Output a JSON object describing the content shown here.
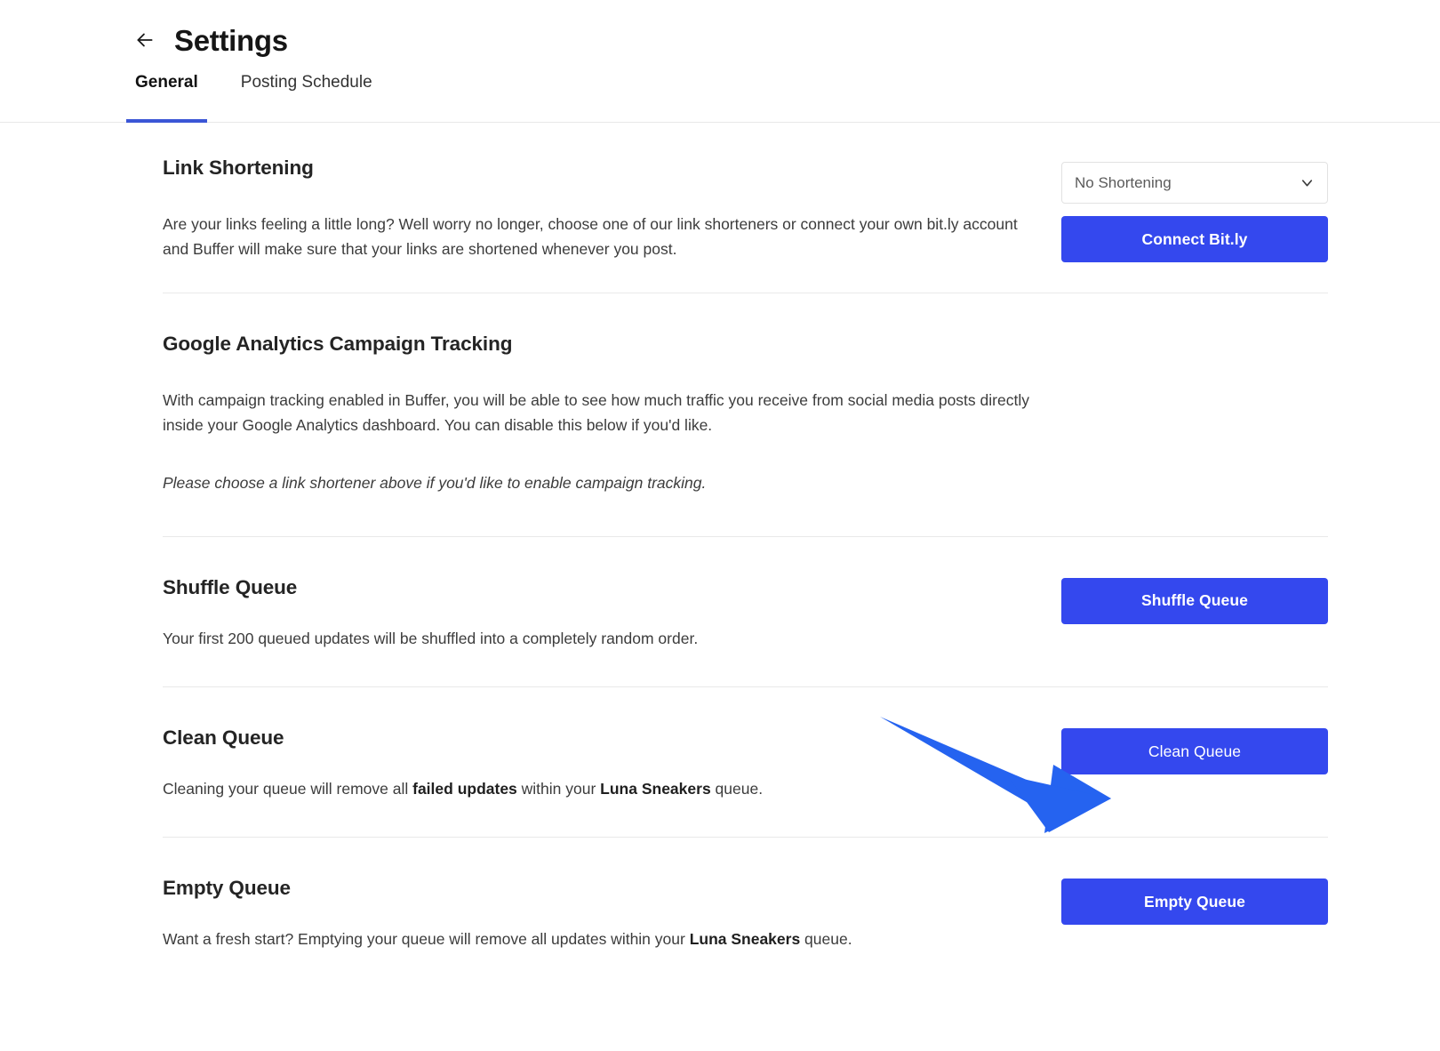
{
  "header": {
    "back_icon": "arrow-left-icon",
    "title": "Settings"
  },
  "tabs": [
    {
      "label": "General",
      "active": true
    },
    {
      "label": "Posting Schedule",
      "active": false
    }
  ],
  "sections": {
    "link_shortening": {
      "title": "Link Shortening",
      "body": "Are your links feeling a little long? Well worry no longer, choose one of our link shorteners or connect your own bit.ly account and Buffer will make sure that your links are shortened whenever you post.",
      "select_value": "No Shortening",
      "select_icon": "chevron-down-icon",
      "button_label": "Connect Bit.ly"
    },
    "ga_tracking": {
      "title": "Google Analytics Campaign Tracking",
      "body": "With campaign tracking enabled in Buffer, you will be able to see how much traffic you receive from social media posts directly inside your Google Analytics dashboard. You can disable this below if you'd like.",
      "note": "Please choose a link shortener above if you'd like to enable campaign tracking."
    },
    "shuffle_queue": {
      "title": "Shuffle Queue",
      "body": "Your first 200 queued updates will be shuffled into a completely random order.",
      "button_label": "Shuffle Queue"
    },
    "clean_queue": {
      "title": "Clean Queue",
      "body_part1": "Cleaning your queue will remove all ",
      "body_bold1": "failed updates",
      "body_part2": " within your ",
      "body_bold2": "Luna Sneakers",
      "body_part3": " queue.",
      "button_label": "Clean Queue"
    },
    "empty_queue": {
      "title": "Empty Queue",
      "body_part1": "Want a fresh start? Emptying your queue will remove all updates within your ",
      "body_bold1": "Luna Sneakers",
      "body_part2": " queue.",
      "button_label": "Empty Queue"
    }
  },
  "annotation": {
    "name": "pointer-arrow-annotation",
    "color": "#2563f0",
    "points_to": "Clean Queue"
  },
  "colors": {
    "primary_button": "#3448ee",
    "tab_underline": "#3b56d6",
    "divider": "#e9e9e9",
    "annotation_arrow": "#2563f0"
  }
}
